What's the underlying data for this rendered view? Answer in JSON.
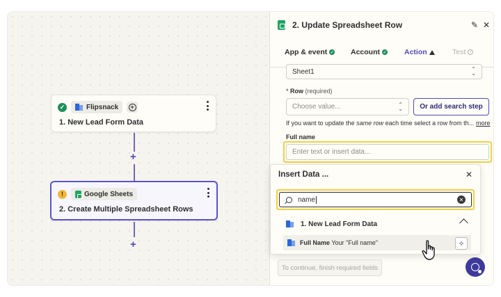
{
  "colors": {
    "accent": "#4f4ab8",
    "success": "#1f8f5a",
    "warning": "#f2b83b",
    "highlight": "#f4d03f"
  },
  "canvas": {
    "step1": {
      "status_icon": "check-circle-icon",
      "app_icon": "flipsnack-icon",
      "app_name": "Flipsnack",
      "title": "1. New Lead Form Data"
    },
    "step2": {
      "status_icon": "warning-circle-icon",
      "app_icon": "google-sheets-icon",
      "app_name": "Google Sheets",
      "title": "2. Create Multiple Spreadsheet Rows"
    },
    "add_step_symbol": "+"
  },
  "panel": {
    "title": "2. Update Spreadsheet Row",
    "tabs": [
      {
        "label": "App & event",
        "state": "complete"
      },
      {
        "label": "Account",
        "state": "complete"
      },
      {
        "label": "Action",
        "state": "warning"
      },
      {
        "label": "Test",
        "state": "disabled"
      }
    ],
    "worksheet_value": "Sheet1",
    "row": {
      "label": "Row",
      "required_note": "(required)",
      "placeholder": "Choose value...",
      "search_button": "Or add search step"
    },
    "helper": {
      "prefix": "If you want to update the ",
      "emphasis": "same row",
      "suffix": " each time select a row from th...",
      "more": "more"
    },
    "full_name": {
      "label": "Full name",
      "placeholder": "Enter text or insert data..."
    },
    "footer_button": "To continue, finish required fields"
  },
  "insert_data": {
    "title": "Insert Data ...",
    "search_value": "name",
    "group_title": "1. New Lead Form Data",
    "result": {
      "field": "Full Name",
      "value": "Your \"Full name\""
    }
  }
}
